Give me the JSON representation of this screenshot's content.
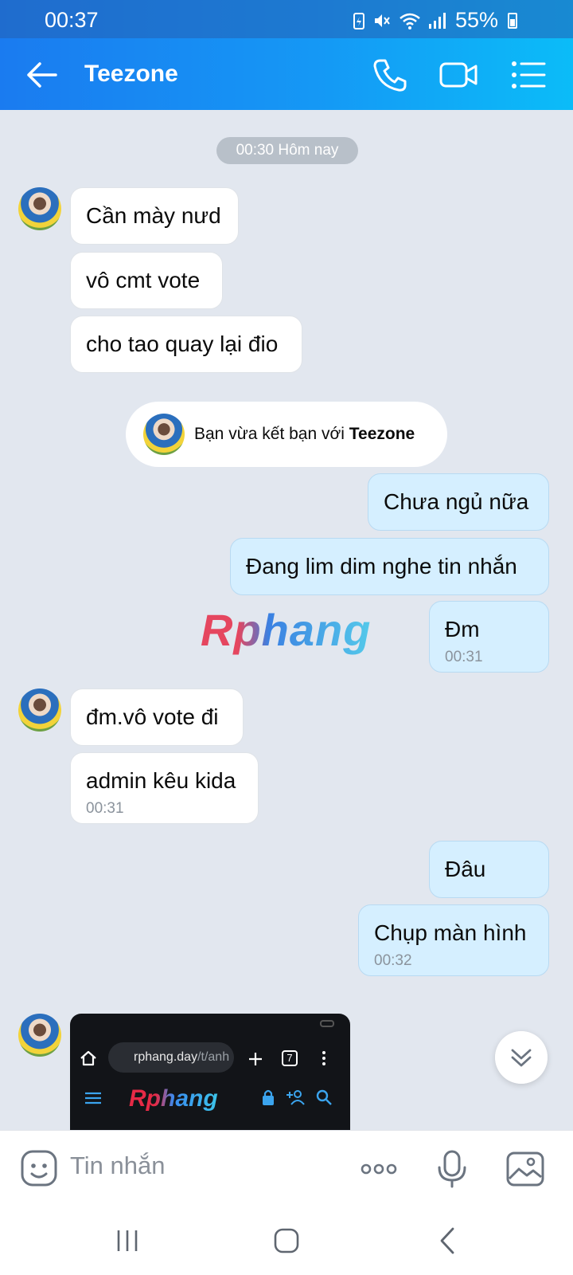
{
  "status": {
    "time": "00:37",
    "battery": "55%"
  },
  "header": {
    "title": "Teezone"
  },
  "chat": {
    "date_label": "00:30 Hôm nay",
    "group1": [
      "Cần mày nưd",
      "vô cmt vote",
      "cho tao quay lại đio"
    ],
    "friend_notice": {
      "prefix": "Bạn vừa kết bạn với ",
      "name": "Teezone"
    },
    "out1": [
      "Chưa ngủ nữa",
      "Đang lim dim nghe tin nhắn"
    ],
    "out1_last": {
      "text": "Đm",
      "time": "00:31"
    },
    "group2": [
      "đm.vô vote đi"
    ],
    "group2_last": {
      "text": "admin kêu kida",
      "time": "00:31"
    },
    "out2": [
      "Đâu"
    ],
    "out2_last": {
      "text": "Chụp màn hình",
      "time": "00:32"
    },
    "screenshot": {
      "url_main": "rphang.day",
      "url_dim": "/t/anh",
      "tab_count": "7",
      "logo": "Rphang"
    }
  },
  "watermark": "Rphang",
  "composer": {
    "placeholder": "Tin nhắn"
  }
}
